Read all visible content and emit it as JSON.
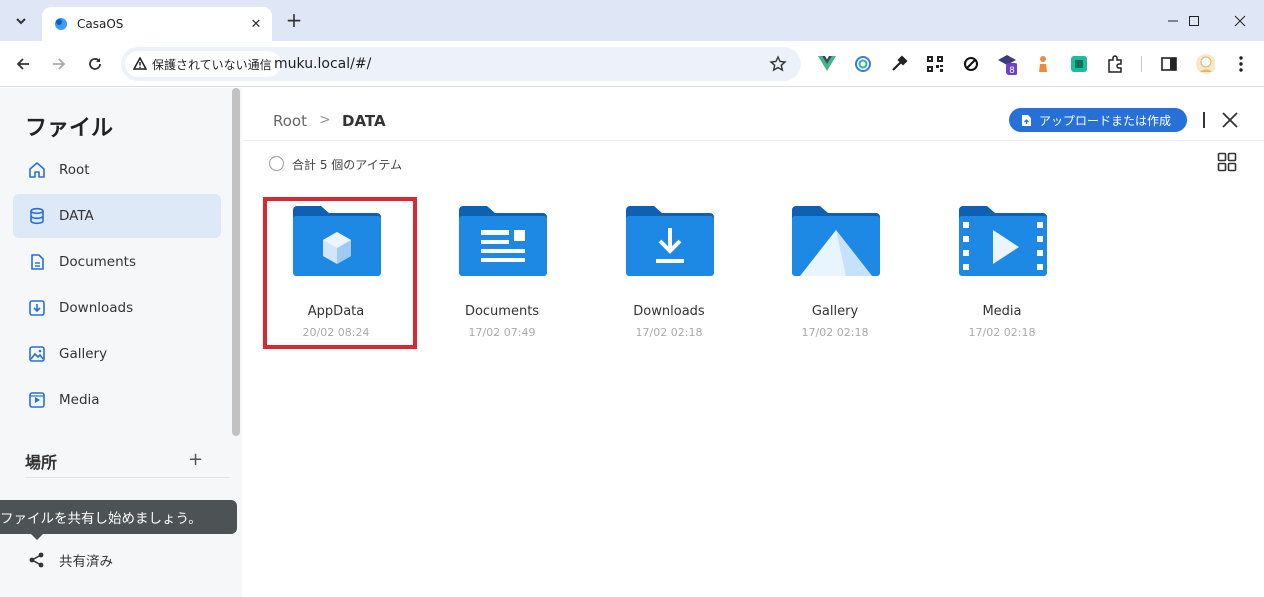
{
  "browser": {
    "tab_title": "CasaOS",
    "security_label": "保護されていない通信",
    "url": "muku.local/#/",
    "extension_badge": "8"
  },
  "sidebar": {
    "title": "ファイル",
    "items": [
      {
        "label": "Root",
        "icon": "home-icon"
      },
      {
        "label": "DATA",
        "icon": "database-icon",
        "active": true
      },
      {
        "label": "Documents",
        "icon": "document-icon"
      },
      {
        "label": "Downloads",
        "icon": "download-icon"
      },
      {
        "label": "Gallery",
        "icon": "image-icon"
      },
      {
        "label": "Media",
        "icon": "video-icon"
      }
    ],
    "locations_title": "場所",
    "add_label": "+",
    "tooltip": "ファイルを共有し始めましょう。",
    "shared_label": "共有済み"
  },
  "main": {
    "breadcrumb_root": "Root",
    "breadcrumb_sep": ">",
    "breadcrumb_current": "DATA",
    "upload_label": "アップロードまたは作成",
    "item_count": "合計 5 個のアイテム",
    "files": [
      {
        "name": "AppData",
        "date": "20/02 08:24",
        "icon": "cube-folder-icon",
        "selected": true
      },
      {
        "name": "Documents",
        "date": "17/02 07:49",
        "icon": "document-folder-icon"
      },
      {
        "name": "Downloads",
        "date": "17/02 02:18",
        "icon": "download-folder-icon"
      },
      {
        "name": "Gallery",
        "date": "17/02 02:18",
        "icon": "image-folder-icon"
      },
      {
        "name": "Media",
        "date": "17/02 02:18",
        "icon": "video-folder-icon"
      }
    ]
  },
  "colors": {
    "accent": "#2670d8",
    "folder_dark": "#0f5fb3",
    "folder_light": "#1e88e5",
    "highlight": "#d9282f"
  }
}
